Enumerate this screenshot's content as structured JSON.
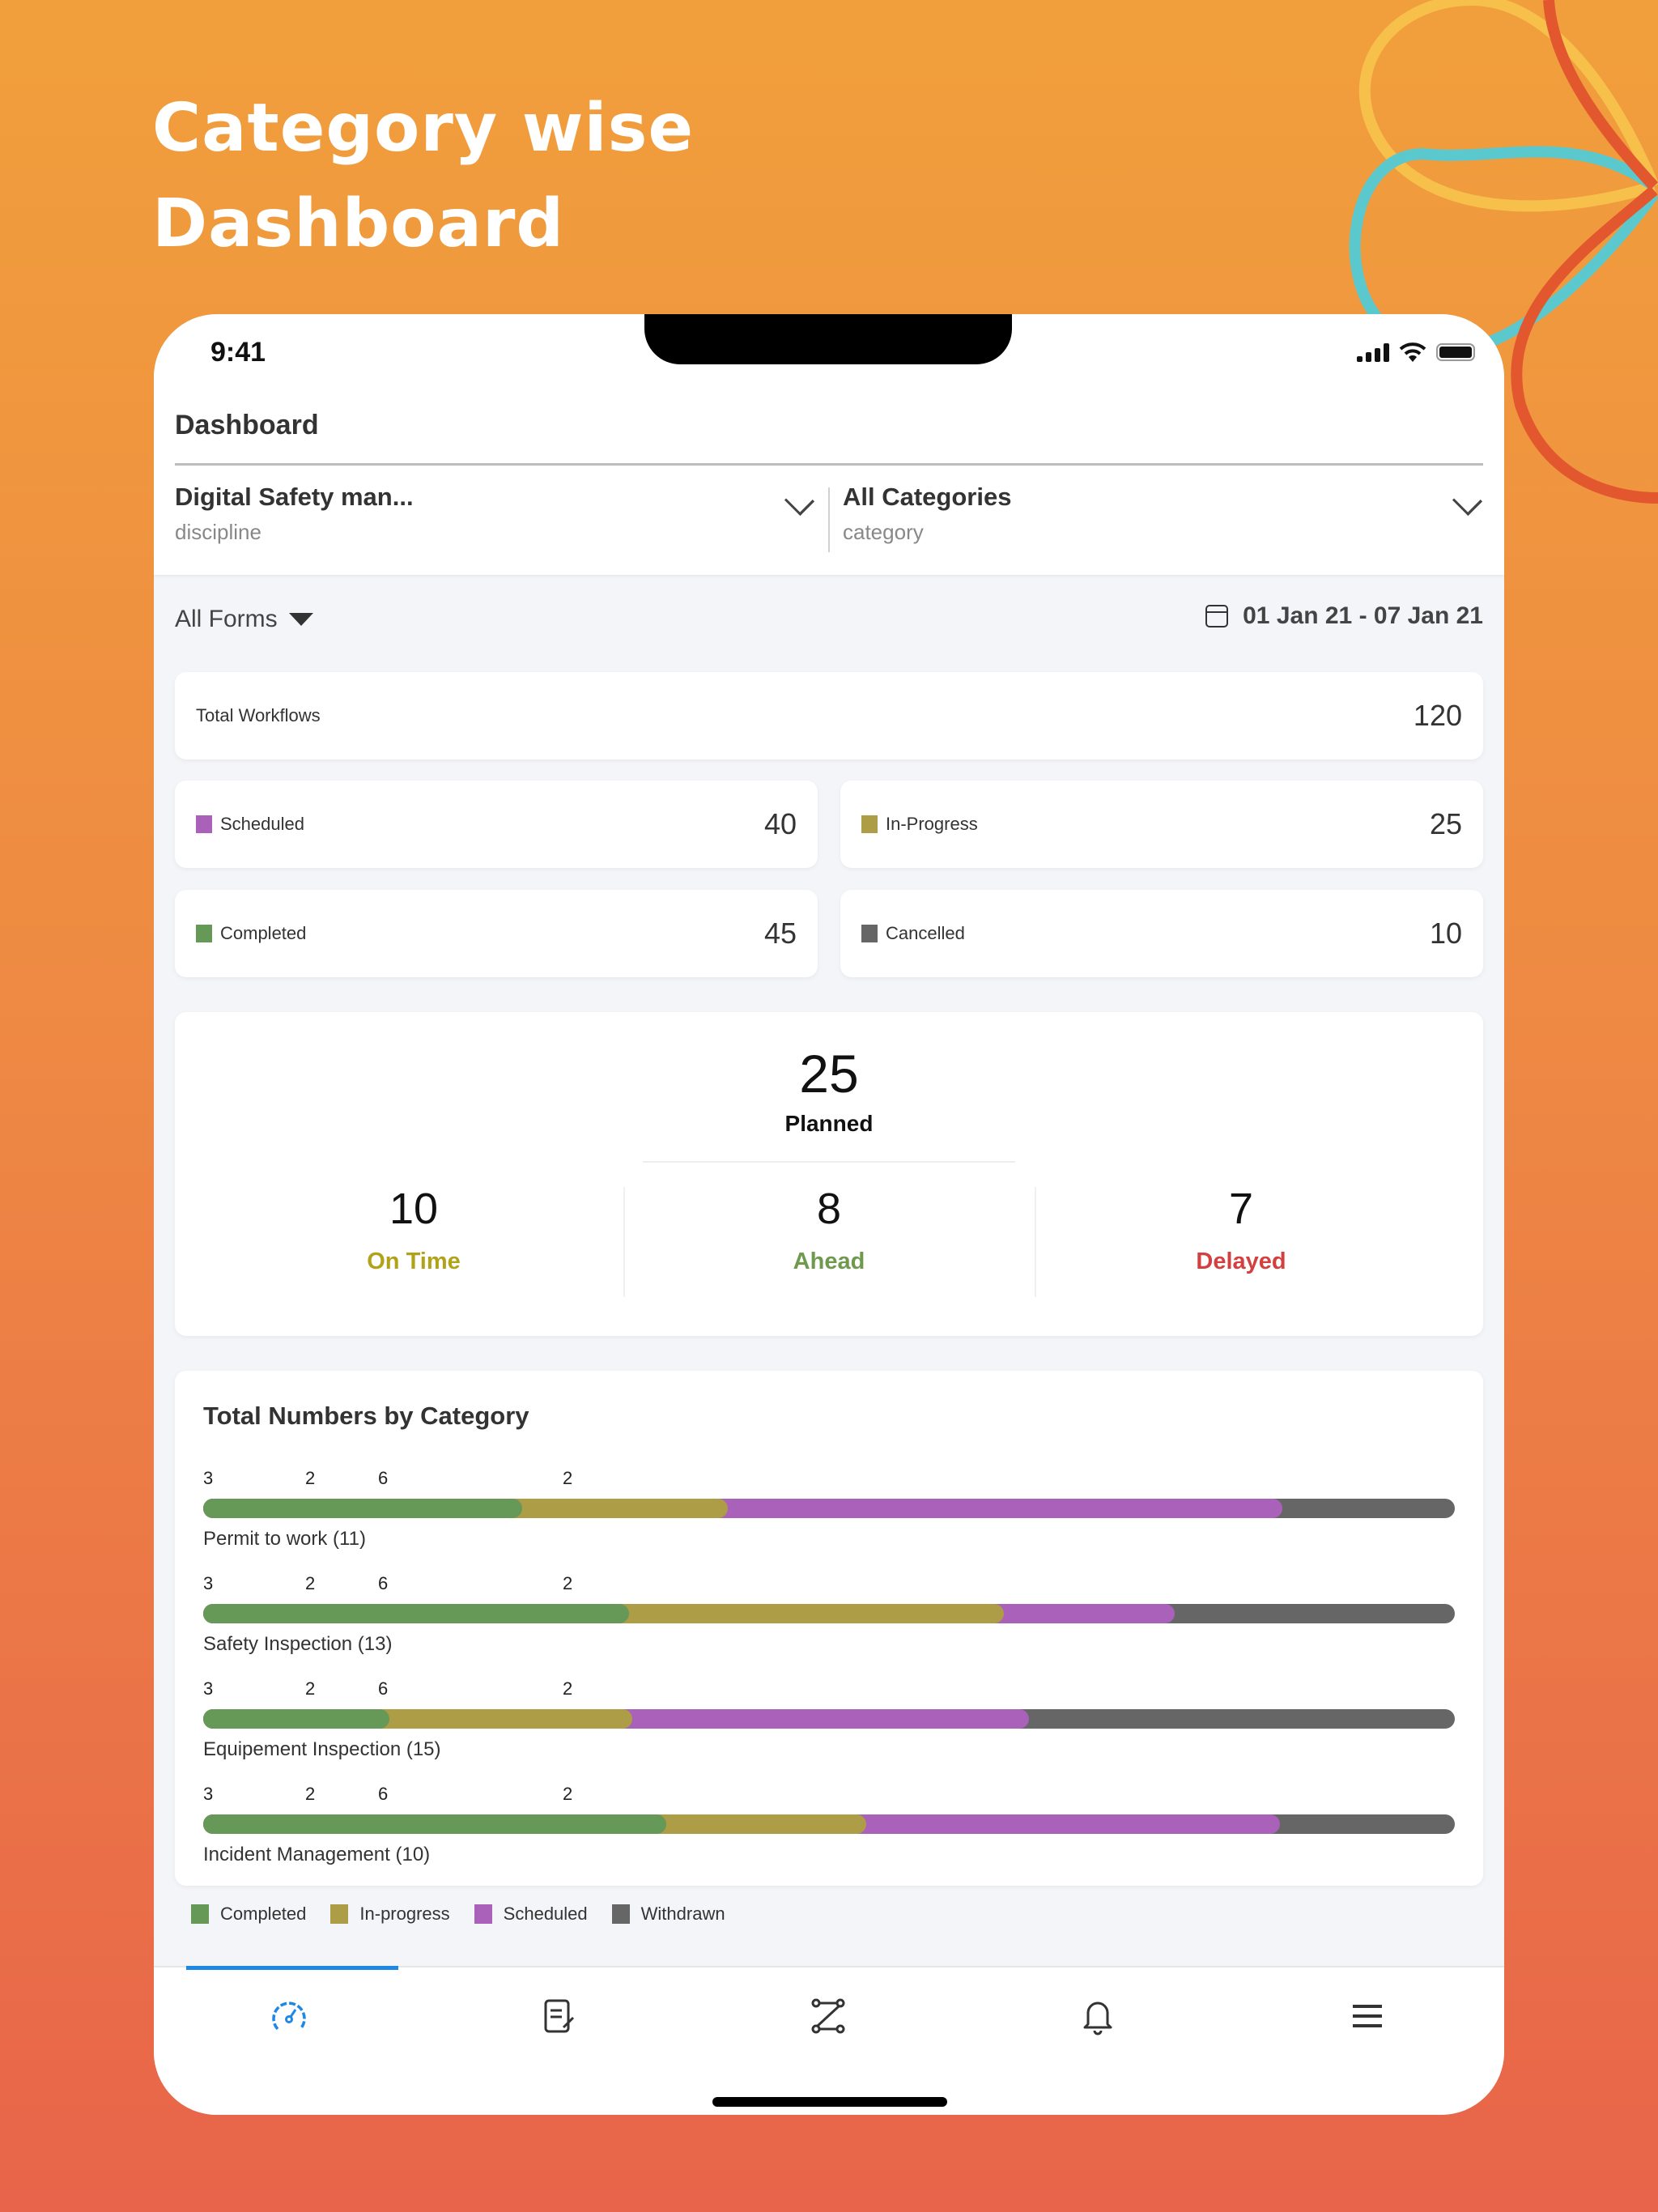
{
  "promo": {
    "title_line1": "Category wise",
    "title_line2": "Dashboard"
  },
  "status_bar": {
    "time": "9:41",
    "icons": [
      "signal-icon",
      "wifi-icon",
      "battery-icon"
    ]
  },
  "header": {
    "title": "Dashboard"
  },
  "selectors": [
    {
      "value": "Digital Safety man...",
      "label": "discipline",
      "icon": "chevron-down-icon"
    },
    {
      "value": "All Categories",
      "label": "category",
      "icon": "chevron-down-icon"
    }
  ],
  "filters": {
    "forms_label": "All Forms",
    "forms_icon": "caret-down-icon",
    "date_icon": "calendar-icon",
    "date_range": "01 Jan 21 - 07 Jan 21"
  },
  "totals": {
    "label": "Total Workflows",
    "value": "120"
  },
  "stats": [
    {
      "label": "Scheduled",
      "value": "40",
      "color": "#A961BA"
    },
    {
      "label": "In-Progress",
      "value": "25",
      "color": "#AD9D47"
    },
    {
      "label": "Completed",
      "value": "45",
      "color": "#669858"
    },
    {
      "label": "Cancelled",
      "value": "10",
      "color": "#666666"
    }
  ],
  "planned": {
    "value": "25",
    "label": "Planned",
    "breakdown": [
      {
        "value": "10",
        "label": "On Time",
        "color": "#B2A219"
      },
      {
        "value": "8",
        "label": "Ahead",
        "color": "#6F9A4E"
      },
      {
        "value": "7",
        "label": "Delayed",
        "color": "#D2403F"
      }
    ]
  },
  "chart_data": {
    "type": "bar",
    "orientation": "horizontal-stacked",
    "title": "Total Numbers by Category",
    "series_names": [
      "Completed",
      "In-progress",
      "Scheduled",
      "Withdrawn"
    ],
    "series_colors": [
      "#669858",
      "#AD9D47",
      "#A961BA",
      "#666666"
    ],
    "segment_labels_note": "Printed labels 3, 2, 6, 2 are repeated unchanged above every bar and do not match the drawn segment widths; they are recorded as shown.",
    "fill_fractions_note": "Bar fill fractions are visual estimates read from segment geometry, not values printed in the screenshot.",
    "categories": [
      {
        "label": "Permit to work (11)",
        "segment_labels": [
          "3",
          "2",
          "6",
          "2"
        ],
        "fill_fractions_estimated": [
          0.255,
          0.164,
          0.443,
          0.138
        ]
      },
      {
        "label": "Safety Inspection  (13)",
        "segment_labels": [
          "3",
          "2",
          "6",
          "2"
        ],
        "fill_fractions_estimated": [
          0.34,
          0.3,
          0.136,
          0.224
        ]
      },
      {
        "label": "Equipement Inspection  (15)",
        "segment_labels": [
          "3",
          "2",
          "6",
          "2"
        ],
        "fill_fractions_estimated": [
          0.149,
          0.194,
          0.317,
          0.34
        ]
      },
      {
        "label": "Incident Management (10)",
        "segment_labels": [
          "3",
          "2",
          "6",
          "2"
        ],
        "fill_fractions_estimated": [
          0.37,
          0.16,
          0.33,
          0.14
        ]
      }
    ],
    "legend": [
      "Completed",
      "In-progress",
      "Scheduled",
      "Withdrawn"
    ],
    "legend_position": "bottom-left"
  },
  "tabbar": {
    "active_index": 0,
    "tabs": [
      {
        "icon": "dashboard-gauge-icon",
        "active": true
      },
      {
        "icon": "form-edit-icon",
        "active": false
      },
      {
        "icon": "workflow-icon",
        "active": false
      },
      {
        "icon": "notification-bell-icon",
        "active": false
      },
      {
        "icon": "menu-icon",
        "active": false
      }
    ],
    "active_color": "#1E88E5"
  }
}
